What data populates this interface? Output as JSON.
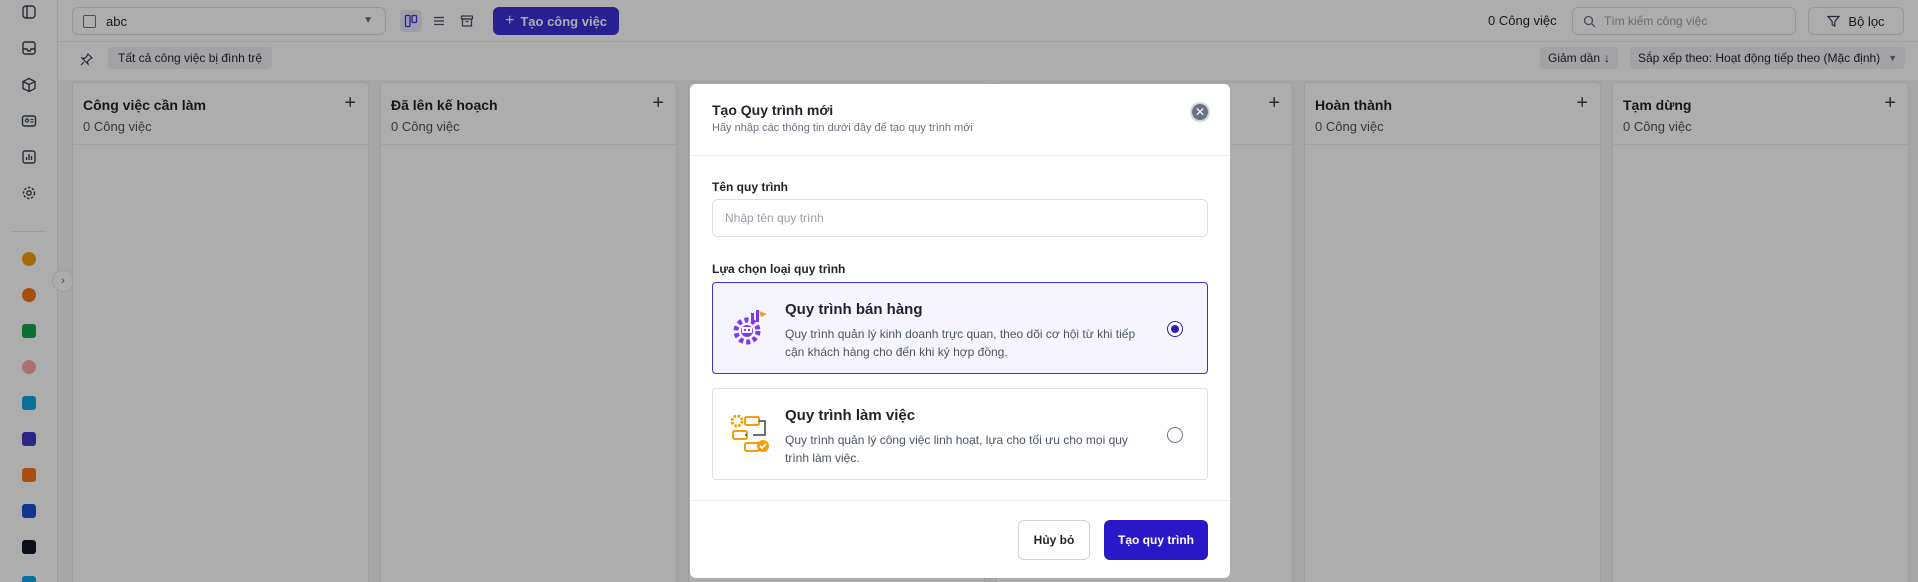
{
  "topbar": {
    "pipeline_name": "abc",
    "create_task_label": "Tạo công việc",
    "task_count": "0 Công việc",
    "search_placeholder": "Tìm kiếm công việc",
    "filter_label": "Bộ lọc"
  },
  "subbar": {
    "stale_label": "Tất cả công việc bị đình trệ",
    "sort_direction": "Giảm dần",
    "sort_by": "Sắp xếp theo: Hoạt động tiếp theo (Mặc định)"
  },
  "columns": [
    {
      "title": "Công việc cần làm",
      "count": "0 Công việc"
    },
    {
      "title": "Đã lên kế hoạch",
      "count": "0 Công việc"
    },
    {
      "title": "",
      "count": ""
    },
    {
      "title": "",
      "count": ""
    },
    {
      "title": "Hoàn thành",
      "count": "0 Công việc"
    },
    {
      "title": "Tạm dừng",
      "count": "0 Công việc"
    }
  ],
  "modal": {
    "title": "Tạo Quy trình mới",
    "subtitle": "Hãy nhập các thông tin dưới đây để tạo quy trình mới",
    "name_label": "Tên quy trình",
    "name_placeholder": "Nhập tên quy trình",
    "name_value": "",
    "type_label": "Lựa chọn loại quy trình",
    "options": [
      {
        "title": "Quy trình bán hàng",
        "description": "Quy trình quản lý kinh doanh trực quan, theo dõi cơ hội từ khi tiếp cận khách hàng cho đến khi ký hợp đồng.",
        "selected": true,
        "icon": "sales-gear-icon"
      },
      {
        "title": "Quy trình làm việc",
        "description": "Quy trình quản lý công việc linh hoạt, lựa cho tối ưu cho mọi quy trình làm việc.",
        "selected": false,
        "icon": "workflow-icon"
      }
    ],
    "cancel_label": "Hủy bỏ",
    "submit_label": "Tạo quy trình"
  },
  "colors": {
    "accent": "#3b2fd6",
    "primary_button": "#2a17c7",
    "selected_bg": "#f5f4ff"
  }
}
